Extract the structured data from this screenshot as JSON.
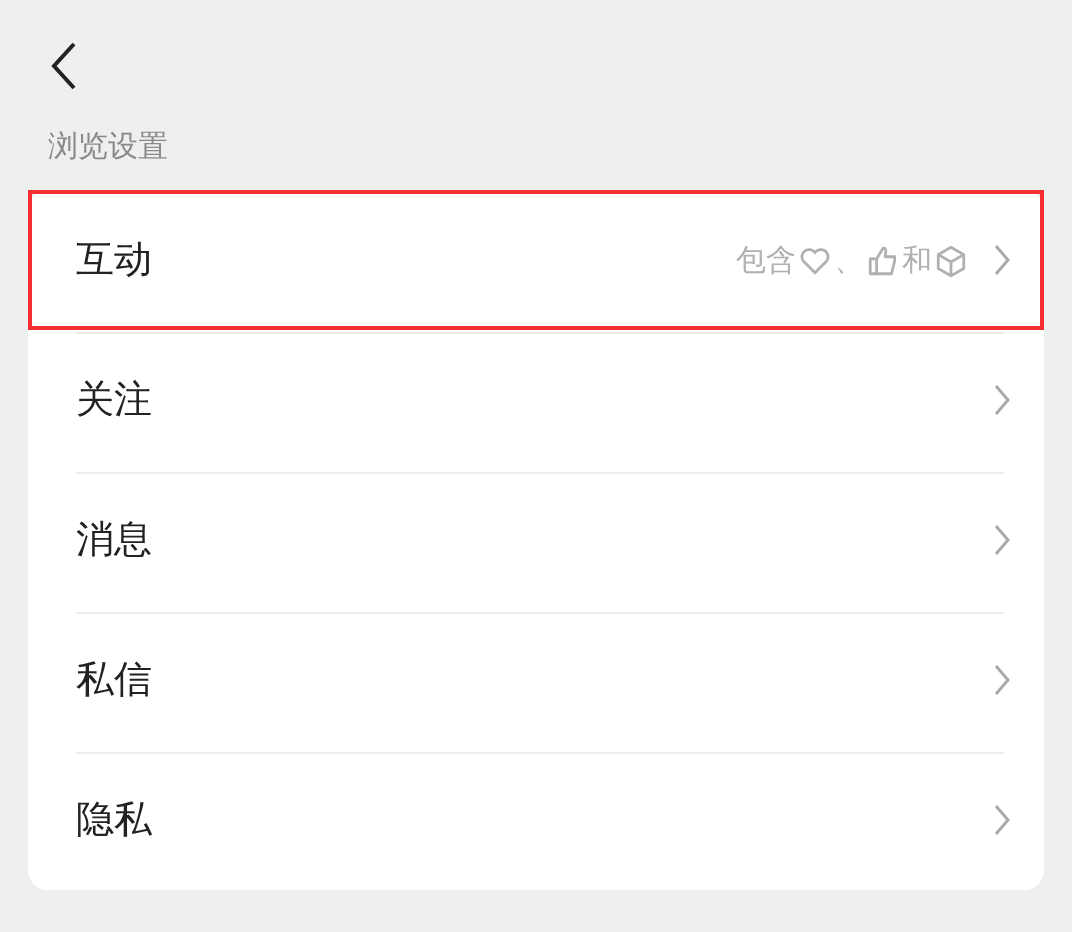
{
  "section_title": "浏览设置",
  "items": [
    {
      "label": "互动",
      "highlighted": true,
      "hint": [
        {
          "kind": "text",
          "text": "包含"
        },
        {
          "kind": "heart"
        },
        {
          "kind": "text",
          "text": "、"
        },
        {
          "kind": "thumb"
        },
        {
          "kind": "text",
          "text": "和"
        },
        {
          "kind": "cube"
        }
      ]
    },
    {
      "label": "关注",
      "highlighted": false
    },
    {
      "label": "消息",
      "highlighted": false
    },
    {
      "label": "私信",
      "highlighted": false
    },
    {
      "label": "隐私",
      "highlighted": false
    }
  ]
}
